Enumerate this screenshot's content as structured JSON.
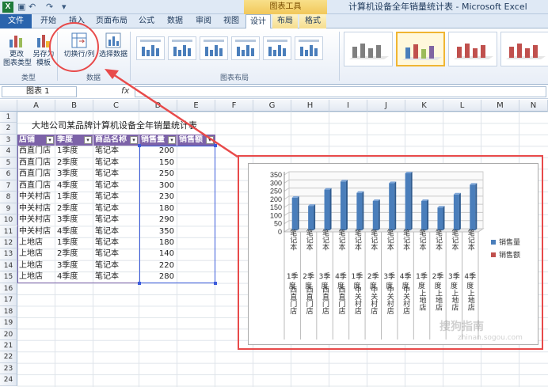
{
  "titlebar": {
    "app_letter": "X",
    "tools_label": "图表工具",
    "window_title": "计算机设备全年销量统计表 - Microsoft Excel"
  },
  "tabs": [
    {
      "label": "文件",
      "kind": "file"
    },
    {
      "label": "开始"
    },
    {
      "label": "插入"
    },
    {
      "label": "页面布局"
    },
    {
      "label": "公式"
    },
    {
      "label": "数据"
    },
    {
      "label": "审阅"
    },
    {
      "label": "视图"
    },
    {
      "label": "设计",
      "kind": "tool-active"
    },
    {
      "label": "布局",
      "kind": "tool"
    },
    {
      "label": "格式",
      "kind": "tool"
    }
  ],
  "ribbon": {
    "change_type": "更改\n图表类型",
    "save_template": "另存为\n模板",
    "group_type": "类型",
    "switch_row_col": "切换行/列",
    "select_data": "选择数据",
    "group_data": "数据",
    "group_layout": "图表布局"
  },
  "formula_bar": {
    "name_box": "图表 1",
    "fx": "fx"
  },
  "columns": [
    "A",
    "B",
    "C",
    "D",
    "E",
    "F",
    "G",
    "H",
    "I",
    "J",
    "K",
    "L",
    "M",
    "N"
  ],
  "rows": [
    "1",
    "2",
    "3",
    "4",
    "5",
    "6",
    "7",
    "8",
    "9",
    "10",
    "11",
    "12",
    "13",
    "14",
    "15",
    "16",
    "17",
    "18",
    "19",
    "20",
    "21",
    "22",
    "23",
    "24"
  ],
  "sheet": {
    "title": "大地公司某品牌计算机设备全年销量统计表",
    "headers": [
      "店铺",
      "季度",
      "商品名称",
      "销售量",
      "销售额"
    ],
    "data": [
      [
        "西直门店",
        "1季度",
        "笔记本",
        "200"
      ],
      [
        "西直门店",
        "2季度",
        "笔记本",
        "150"
      ],
      [
        "西直门店",
        "3季度",
        "笔记本",
        "250"
      ],
      [
        "西直门店",
        "4季度",
        "笔记本",
        "300"
      ],
      [
        "中关村店",
        "1季度",
        "笔记本",
        "230"
      ],
      [
        "中关村店",
        "2季度",
        "笔记本",
        "180"
      ],
      [
        "中关村店",
        "3季度",
        "笔记本",
        "290"
      ],
      [
        "中关村店",
        "4季度",
        "笔记本",
        "350"
      ],
      [
        "上地店",
        "1季度",
        "笔记本",
        "180"
      ],
      [
        "上地店",
        "2季度",
        "笔记本",
        "140"
      ],
      [
        "上地店",
        "3季度",
        "笔记本",
        "220"
      ],
      [
        "上地店",
        "4季度",
        "笔记本",
        "280"
      ]
    ]
  },
  "chart_data": {
    "type": "bar",
    "categories": [
      [
        "笔记本",
        "1季度",
        "西直门店"
      ],
      [
        "笔记本",
        "2季度",
        "西直门店"
      ],
      [
        "笔记本",
        "3季度",
        "西直门店"
      ],
      [
        "笔记本",
        "4季度",
        "西直门店"
      ],
      [
        "笔记本",
        "1季度",
        "中关村店"
      ],
      [
        "笔记本",
        "2季度",
        "中关村店"
      ],
      [
        "笔记本",
        "3季度",
        "中关村店"
      ],
      [
        "笔记本",
        "4季度",
        "中关村店"
      ],
      [
        "笔记本",
        "1季度",
        "上地店"
      ],
      [
        "笔记本",
        "2季度",
        "上地店"
      ],
      [
        "笔记本",
        "3季度",
        "上地店"
      ],
      [
        "笔记本",
        "4季度",
        "上地店"
      ]
    ],
    "series": [
      {
        "name": "销售量",
        "values": [
          200,
          150,
          250,
          300,
          230,
          180,
          290,
          350,
          180,
          140,
          220,
          280
        ],
        "color": "#4a7ebb"
      },
      {
        "name": "销售额",
        "values": [],
        "color": "#c0504d"
      }
    ],
    "yticks": [
      0,
      50,
      100,
      150,
      200,
      250,
      300,
      350
    ],
    "ylim": [
      0,
      350
    ],
    "legend": "right",
    "grid": true
  },
  "watermark": {
    "main": "搜狗指南",
    "sub": "zhinan.sogou.com"
  }
}
